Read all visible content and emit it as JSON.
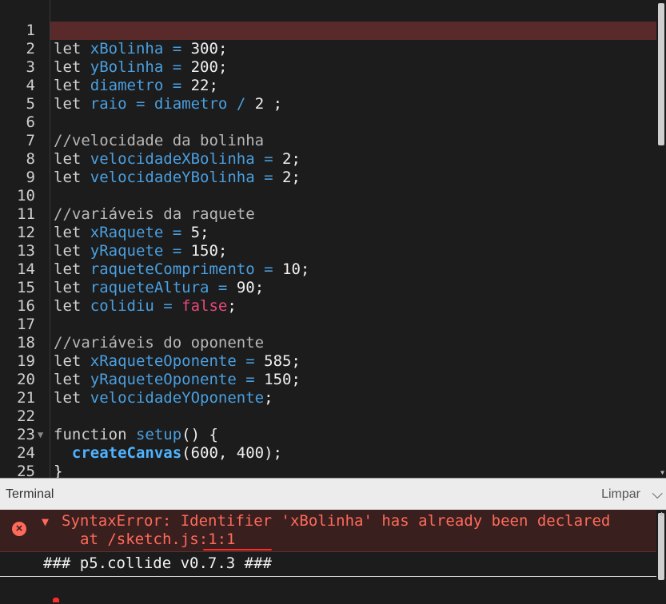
{
  "editor": {
    "active_line": 1,
    "lines": [
      {
        "n": "1",
        "tokens": []
      },
      {
        "n": "2",
        "tokens": [
          [
            "kw",
            "let "
          ],
          [
            "var",
            "xBolinha"
          ],
          [
            "op",
            " = "
          ],
          [
            "num",
            "300"
          ],
          [
            "num",
            ";"
          ]
        ]
      },
      {
        "n": "3",
        "tokens": [
          [
            "kw",
            "let "
          ],
          [
            "var",
            "yBolinha"
          ],
          [
            "op",
            " = "
          ],
          [
            "num",
            "200"
          ],
          [
            "num",
            ";"
          ]
        ]
      },
      {
        "n": "4",
        "tokens": [
          [
            "kw",
            "let "
          ],
          [
            "var",
            "diametro"
          ],
          [
            "op",
            " = "
          ],
          [
            "num",
            "22"
          ],
          [
            "num",
            ";"
          ]
        ]
      },
      {
        "n": "5",
        "tokens": [
          [
            "kw",
            "let "
          ],
          [
            "var",
            "raio"
          ],
          [
            "op",
            " = "
          ],
          [
            "var",
            "diametro"
          ],
          [
            "op",
            " / "
          ],
          [
            "num",
            "2 ;"
          ]
        ]
      },
      {
        "n": "6",
        "tokens": []
      },
      {
        "n": "7",
        "tokens": [
          [
            "cm",
            "//velocidade da bolinha"
          ]
        ]
      },
      {
        "n": "8",
        "tokens": [
          [
            "kw",
            "let "
          ],
          [
            "var",
            "velocidadeXBolinha"
          ],
          [
            "op",
            " = "
          ],
          [
            "num",
            "2;"
          ]
        ]
      },
      {
        "n": "9",
        "tokens": [
          [
            "kw",
            "let "
          ],
          [
            "var",
            "velocidadeYBolinha"
          ],
          [
            "op",
            " = "
          ],
          [
            "num",
            "2;"
          ]
        ]
      },
      {
        "n": "10",
        "tokens": []
      },
      {
        "n": "11",
        "tokens": [
          [
            "cm",
            "//variáveis da raquete"
          ]
        ]
      },
      {
        "n": "12",
        "tokens": [
          [
            "kw",
            "let "
          ],
          [
            "var",
            "xRaquete"
          ],
          [
            "op",
            " = "
          ],
          [
            "num",
            "5;"
          ]
        ]
      },
      {
        "n": "13",
        "tokens": [
          [
            "kw",
            "let "
          ],
          [
            "var",
            "yRaquete"
          ],
          [
            "op",
            " = "
          ],
          [
            "num",
            "150;"
          ]
        ]
      },
      {
        "n": "14",
        "tokens": [
          [
            "kw",
            "let "
          ],
          [
            "var",
            "raqueteComprimento"
          ],
          [
            "op",
            " = "
          ],
          [
            "num",
            "10;"
          ]
        ]
      },
      {
        "n": "15",
        "tokens": [
          [
            "kw",
            "let "
          ],
          [
            "var",
            "raqueteAltura"
          ],
          [
            "op",
            " = "
          ],
          [
            "num",
            "90;"
          ]
        ]
      },
      {
        "n": "16",
        "tokens": [
          [
            "kw",
            "let "
          ],
          [
            "var",
            "colidiu"
          ],
          [
            "op",
            " = "
          ],
          [
            "bool",
            "false"
          ],
          [
            "num",
            ";"
          ]
        ]
      },
      {
        "n": "17",
        "tokens": []
      },
      {
        "n": "18",
        "tokens": [
          [
            "cm",
            "//variáveis do oponente"
          ]
        ]
      },
      {
        "n": "19",
        "tokens": [
          [
            "kw",
            "let "
          ],
          [
            "var",
            "xRaqueteOponente"
          ],
          [
            "op",
            " = "
          ],
          [
            "num",
            "585;"
          ]
        ]
      },
      {
        "n": "20",
        "tokens": [
          [
            "kw",
            "let "
          ],
          [
            "var",
            "yRaqueteOponente"
          ],
          [
            "op",
            " = "
          ],
          [
            "num",
            "150;"
          ]
        ]
      },
      {
        "n": "21",
        "tokens": [
          [
            "kw",
            "let "
          ],
          [
            "var",
            "velocidadeYOponente"
          ],
          [
            "num",
            ";"
          ]
        ]
      },
      {
        "n": "22",
        "tokens": []
      },
      {
        "n": "23",
        "fold": true,
        "tokens": [
          [
            "kw",
            "function "
          ],
          [
            "var",
            "setup"
          ],
          [
            "num",
            "() {"
          ]
        ]
      },
      {
        "n": "24",
        "tokens": [
          [
            "num",
            "  "
          ],
          [
            "call",
            "createCanvas"
          ],
          [
            "num",
            "(600, 400);"
          ]
        ]
      },
      {
        "n": "25",
        "tokens": [
          [
            "num",
            "}"
          ]
        ]
      }
    ]
  },
  "terminal": {
    "title": "Terminal",
    "clear_label": "Limpar",
    "error_message": "SyntaxError: Identifier 'xBolinha' has already been declared",
    "error_location": "at /sketch.js:1:1",
    "log_message": "### p5.collide v0.7.3 ###"
  },
  "colors": {
    "background": "#1c1c1c",
    "active_line": "#5a2a2a",
    "error_text": "#ff6a5a",
    "variable": "#4a9fe0",
    "boolean": "#e8487a"
  }
}
